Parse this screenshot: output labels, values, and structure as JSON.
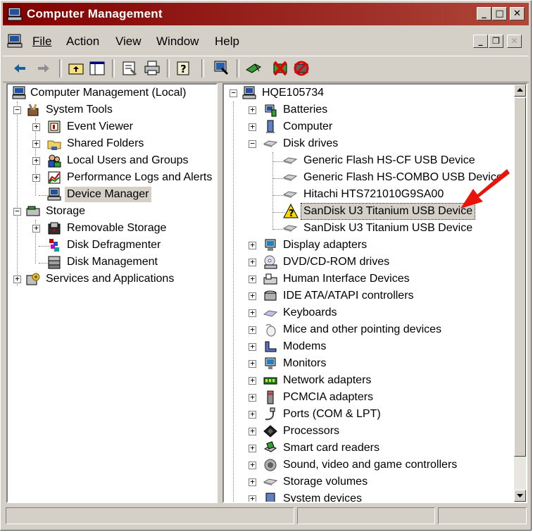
{
  "window": {
    "title": "Computer Management"
  },
  "menu": {
    "items": [
      "File",
      "Action",
      "View",
      "Window",
      "Help"
    ]
  },
  "left_tree": {
    "root": "Computer Management (Local)",
    "system_tools": "System Tools",
    "event_viewer": "Event Viewer",
    "shared_folders": "Shared Folders",
    "local_users": "Local Users and Groups",
    "perf_logs": "Performance Logs and Alerts",
    "device_manager": "Device Manager",
    "storage": "Storage",
    "removable_storage": "Removable Storage",
    "disk_defrag": "Disk Defragmenter",
    "disk_mgmt": "Disk Management",
    "services": "Services and Applications"
  },
  "right_tree": {
    "root": "HQE105734",
    "batteries": "Batteries",
    "computer": "Computer",
    "disk_drives": "Disk drives",
    "drives": [
      "Generic Flash HS-CF USB Device",
      "Generic Flash HS-COMBO USB Device",
      "Hitachi HTS721010G9SA00",
      "SanDisk U3 Titanium USB Device",
      "SanDisk U3 Titanium USB Device"
    ],
    "categories": [
      "Display adapters",
      "DVD/CD-ROM drives",
      "Human Interface Devices",
      "IDE ATA/ATAPI controllers",
      "Keyboards",
      "Mice and other pointing devices",
      "Modems",
      "Monitors",
      "Network adapters",
      "PCMCIA adapters",
      "Ports (COM & LPT)",
      "Processors",
      "Smart card readers",
      "Sound, video and game controllers",
      "Storage volumes",
      "System devices"
    ]
  },
  "colors": {
    "title_bar": "#800000",
    "arrow": "#e8140c",
    "face": "#d4d0c8"
  }
}
